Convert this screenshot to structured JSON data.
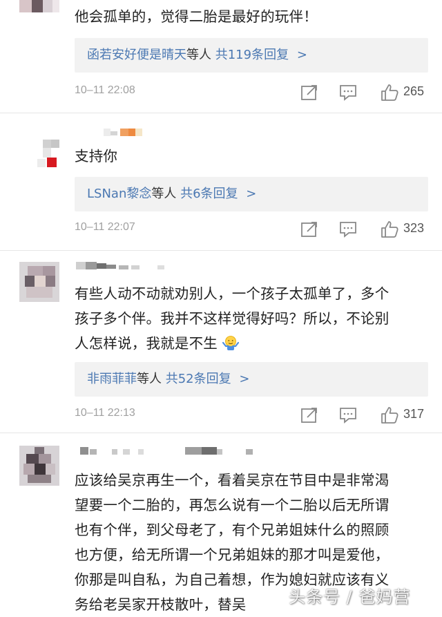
{
  "comments": [
    {
      "text": "他会孤单的，觉得二胎是最好的玩伴！",
      "reply_names": "函若安好便是晴天",
      "reply_mid": "等人",
      "reply_count": "共119条回复",
      "reply_arrow": ">",
      "time": "10–11 22:08",
      "likes": "265"
    },
    {
      "text": "支持你",
      "reply_names": "LSNan黎念",
      "reply_mid": "等人",
      "reply_count": "共6条回复",
      "reply_arrow": ">",
      "time": "10–11 22:07",
      "likes": "323"
    },
    {
      "lines": [
        "有些人动不动就劝别人，一个孩子太孤单了，多个",
        "孩子多个伴。我并不这样觉得好吗？所以，不论别",
        "人怎样说，我就是不生"
      ],
      "reply_names": "非雨菲菲",
      "reply_mid": "等人",
      "reply_count": "共52条回复",
      "reply_arrow": ">",
      "time": "10–11 22:13",
      "likes": "317",
      "emoji": "shrug-emoji"
    },
    {
      "lines": [
        "应该给吴京再生一个，看着吴京在节目中是非常渴",
        "望要一个二胎的，再怎么说有一个二胎以后无所谓",
        "也有个伴，到父母老了，有个兄弟姐妹什么的照顾",
        "也方便，给无所谓一个兄弟姐妹的那才叫是爱他，",
        "你那是叫自私，为自己着想，作为媳妇就应该有义",
        "务给老吴家开枝散叶，替吴"
      ]
    }
  ],
  "watermark": "头条号 / 爸妈营",
  "colors": {
    "link": "#4b78b2",
    "reply_bg": "#f2f2f2",
    "meta_gray": "#a0a0a0",
    "text": "#222222"
  },
  "icons": [
    "share-icon",
    "comment-icon",
    "like-icon"
  ]
}
